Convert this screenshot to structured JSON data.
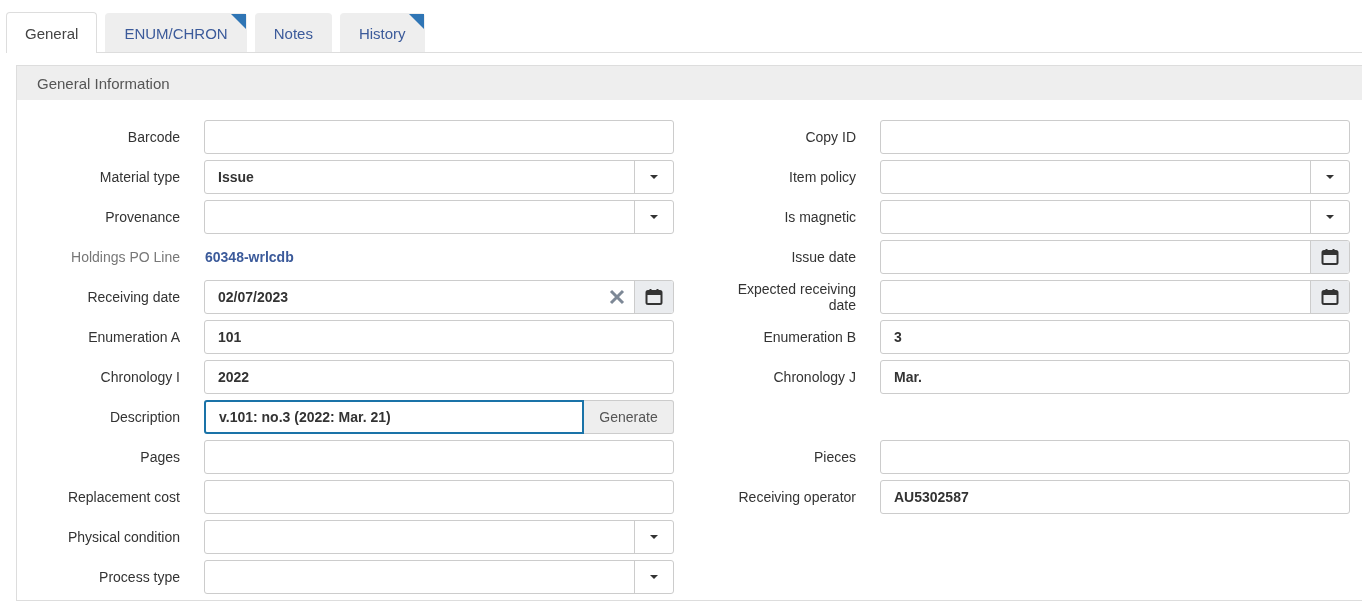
{
  "tabs": [
    {
      "label": "General",
      "selected": true,
      "flagged": false
    },
    {
      "label": "ENUM/CHRON",
      "selected": false,
      "flagged": true
    },
    {
      "label": "Notes",
      "selected": false,
      "flagged": false
    },
    {
      "label": "History",
      "selected": false,
      "flagged": true
    }
  ],
  "section": {
    "title": "General Information"
  },
  "rows": [
    {
      "left": {
        "label": "Barcode",
        "kind": "text"
      },
      "right": {
        "label": "Copy ID",
        "kind": "text"
      }
    },
    {
      "left": {
        "label": "Material type",
        "kind": "select",
        "value": "Issue"
      },
      "right": {
        "label": "Item policy",
        "kind": "select"
      }
    },
    {
      "left": {
        "label": "Provenance",
        "kind": "select"
      },
      "right": {
        "label": "Is magnetic",
        "kind": "select"
      }
    },
    {
      "left": {
        "label": "Holdings PO Line",
        "kind": "link",
        "value": "60348-wrlcdb"
      },
      "right": {
        "label": "Issue date",
        "kind": "date",
        "clearable": false
      }
    },
    {
      "left": {
        "label": "Receiving date",
        "kind": "date",
        "value": "02/07/2023",
        "clearable": true
      },
      "right": {
        "label": "Expected receiving date",
        "kind": "date",
        "clearable": false
      }
    },
    {
      "left": {
        "label": "Enumeration A",
        "kind": "text",
        "value": "101"
      },
      "right": {
        "label": "Enumeration B",
        "kind": "text",
        "value": "3"
      }
    },
    {
      "left": {
        "label": "Chronology I",
        "kind": "text",
        "value": "2022"
      },
      "right": {
        "label": "Chronology J",
        "kind": "text",
        "value": "Mar."
      }
    },
    {
      "left": {
        "label": "Description",
        "kind": "generate",
        "value": "v.101: no.3 (2022: Mar. 21)",
        "button": "Generate",
        "focused": true
      }
    },
    {
      "left": {
        "label": "Pages",
        "kind": "text"
      },
      "right": {
        "label": "Pieces",
        "kind": "text"
      }
    },
    {
      "left": {
        "label": "Replacement cost",
        "kind": "text"
      },
      "right": {
        "label": "Receiving operator",
        "kind": "text",
        "value": "AU5302587"
      }
    },
    {
      "left": {
        "label": "Physical condition",
        "kind": "select"
      }
    },
    {
      "left": {
        "label": "Process type",
        "kind": "select"
      }
    }
  ]
}
